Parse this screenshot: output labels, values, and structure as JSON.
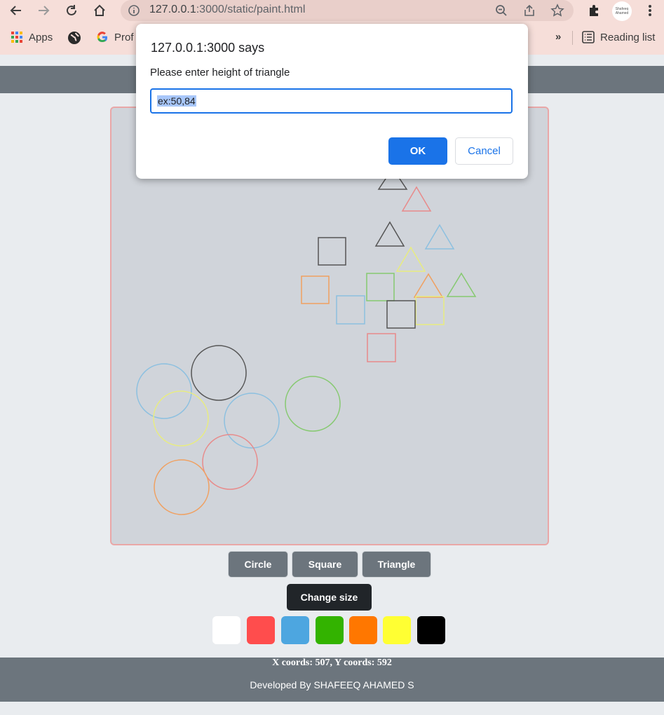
{
  "browser": {
    "url_host": "127.0.0.1",
    "url_path": ":3000/static/paint.html",
    "bookmarks": {
      "apps": "Apps",
      "profile": "Prof",
      "reading_list": "Reading list"
    },
    "profile_avatar_text": "Shafeeq Ahamed"
  },
  "dialog": {
    "title": "127.0.0.1:3000 says",
    "message": "Please enter height of triangle",
    "input_value": "ex:50,84",
    "ok_label": "OK",
    "cancel_label": "Cancel"
  },
  "shape_buttons": [
    "Circle",
    "Square",
    "Triangle"
  ],
  "change_size_label": "Change size",
  "swatches": [
    "#ffffff",
    "#ff4d4d",
    "#4da6e0",
    "#33b300",
    "#ff7700",
    "#ffff33",
    "#000000"
  ],
  "colors": {
    "red": "#e88a8a",
    "blue": "#8cc0e0",
    "green": "#86c970",
    "orange": "#f0a060",
    "yellow": "#e8ec80",
    "gray": "#555555"
  },
  "footer": {
    "coords": "X coords: 507, Y coords: 592",
    "developer": "Developed By SHAFEEQ AHAMED S"
  }
}
